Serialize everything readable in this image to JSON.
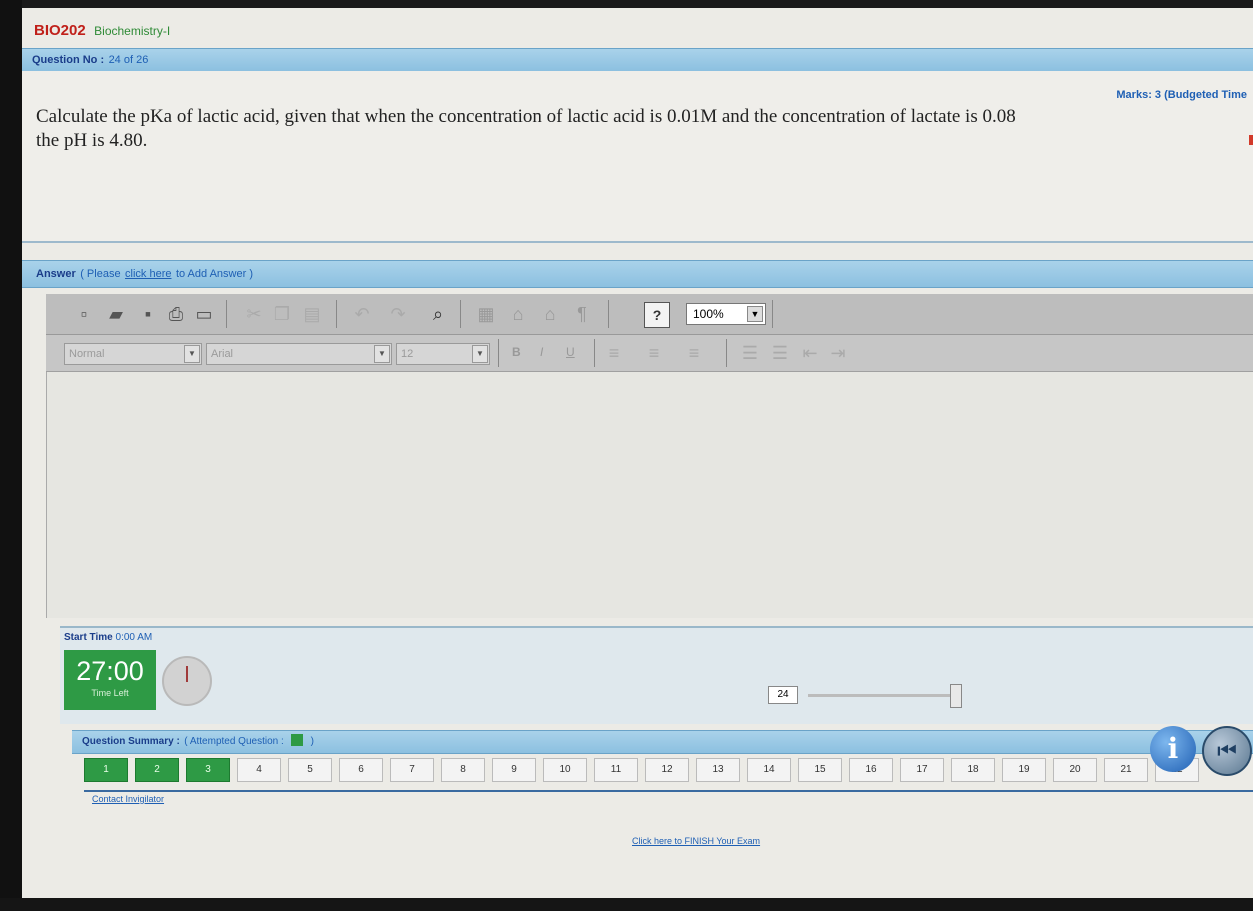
{
  "course": {
    "code": "BIO202",
    "name": "Biochemistry-I"
  },
  "question_bar": {
    "label": "Question No :",
    "value": "24 of 26"
  },
  "marks": "Marks: 3 (Budgeted Time",
  "question": {
    "text": "Calculate the pKa of lactic acid, given that when the concentration of lactic acid is 0.01M and the concentration of lactate is 0.08",
    "text_line2": "the pH is 4.80."
  },
  "answer_bar": {
    "label": "Answer",
    "hint_prefix": "( Please",
    "link": "click here",
    "hint_suffix": "to Add Answer )"
  },
  "toolbar": {
    "zoom": "100%",
    "icons": [
      "new-icon",
      "open-icon",
      "save-icon",
      "print-icon",
      "print-preview-icon",
      "cut-icon",
      "copy-icon",
      "paste-icon",
      "undo-icon",
      "redo-icon",
      "find-icon",
      "insert-image-icon",
      "home-icon",
      "table-icon",
      "paragraph-icon",
      "help-icon"
    ]
  },
  "format_bar": {
    "style": "Normal",
    "font": "Arial",
    "size": "12",
    "bold": "B",
    "italic": "I",
    "underline": "U"
  },
  "timer": {
    "start_label": "Start Time",
    "start_value": "0:00 AM",
    "remaining": "27:00",
    "remaining_label": "Time Left"
  },
  "navigator": {
    "current": "24"
  },
  "summary": {
    "label": "Question Summary :",
    "hint_prefix": "( Attempted Question :",
    "hint_suffix": ")"
  },
  "questions": [
    {
      "n": "1",
      "done": true
    },
    {
      "n": "2",
      "done": true
    },
    {
      "n": "3",
      "done": true
    },
    {
      "n": "4",
      "done": false
    },
    {
      "n": "5",
      "done": false
    },
    {
      "n": "6",
      "done": false
    },
    {
      "n": "7",
      "done": false
    },
    {
      "n": "8",
      "done": false
    },
    {
      "n": "9",
      "done": false
    },
    {
      "n": "10",
      "done": false
    },
    {
      "n": "11",
      "done": false
    },
    {
      "n": "12",
      "done": false
    },
    {
      "n": "13",
      "done": false
    },
    {
      "n": "14",
      "done": false
    },
    {
      "n": "15",
      "done": false
    },
    {
      "n": "16",
      "done": false
    },
    {
      "n": "17",
      "done": false
    },
    {
      "n": "18",
      "done": false
    },
    {
      "n": "19",
      "done": false
    },
    {
      "n": "20",
      "done": false
    },
    {
      "n": "21",
      "done": false
    },
    {
      "n": "22",
      "done": false
    }
  ],
  "links": {
    "contact": "Contact Invigilator",
    "finish": "Click here to FINISH Your Exam"
  },
  "colors": {
    "accent_bar": "#8cc0e0",
    "attempted": "#2e9a45",
    "code_red": "#c0201a"
  }
}
